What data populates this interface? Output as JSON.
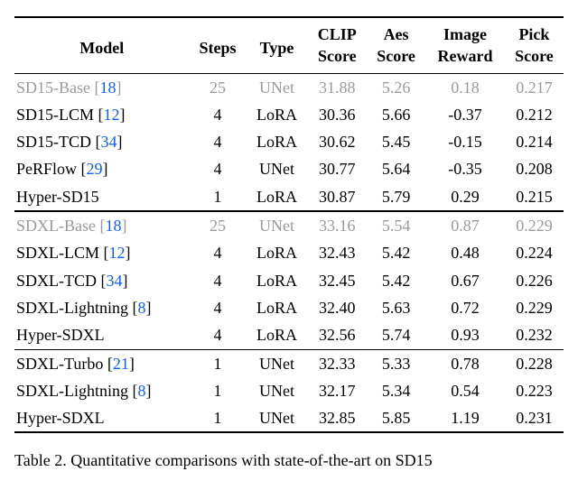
{
  "chart_data": {
    "type": "table",
    "title": "Table 2",
    "columns": [
      "Model",
      "Steps",
      "Type",
      "CLIP Score",
      "Aes Score",
      "Image Reward",
      "Pick Score"
    ],
    "groups": [
      {
        "rows": [
          {
            "model": "SD15-Base",
            "cite": "18",
            "steps": 25,
            "type": "UNet",
            "clip": 31.88,
            "aes": 5.26,
            "ir": 0.18,
            "pick": 0.217,
            "muted": true
          },
          {
            "model": "SD15-LCM",
            "cite": "12",
            "steps": 4,
            "type": "LoRA",
            "clip": 30.36,
            "aes": 5.66,
            "ir": -0.37,
            "pick": 0.212
          },
          {
            "model": "SD15-TCD",
            "cite": "34",
            "steps": 4,
            "type": "LoRA",
            "clip": 30.62,
            "aes": 5.45,
            "ir": -0.15,
            "pick": 0.214
          },
          {
            "model": "PeRFlow",
            "cite": "29",
            "steps": 4,
            "type": "UNet",
            "clip": 30.77,
            "aes": 5.64,
            "ir": -0.35,
            "pick": 0.208
          },
          {
            "model": "Hyper-SD15",
            "steps": 1,
            "type": "LoRA",
            "clip": 30.87,
            "aes": 5.79,
            "ir": 0.29,
            "pick": 0.215,
            "bold": true
          }
        ]
      },
      {
        "rows": [
          {
            "model": "SDXL-Base",
            "cite": "18",
            "steps": 25,
            "type": "UNet",
            "clip": 33.16,
            "aes": 5.54,
            "ir": 0.87,
            "pick": 0.229,
            "muted": true
          },
          {
            "model": "SDXL-LCM",
            "cite": "12",
            "steps": 4,
            "type": "LoRA",
            "clip": 32.43,
            "aes": 5.42,
            "ir": 0.48,
            "pick": 0.224
          },
          {
            "model": "SDXL-TCD",
            "cite": "34",
            "steps": 4,
            "type": "LoRA",
            "clip": 32.45,
            "aes": 5.42,
            "ir": 0.67,
            "pick": 0.226
          },
          {
            "model": "SDXL-Lightning",
            "cite": "8",
            "steps": 4,
            "type": "LoRA",
            "clip": 32.4,
            "aes": 5.63,
            "ir": 0.72,
            "pick": 0.229
          },
          {
            "model": "Hyper-SDXL",
            "steps": 4,
            "type": "LoRA",
            "clip": 32.56,
            "aes": 5.74,
            "ir": 0.93,
            "pick": 0.232,
            "bold": true
          }
        ]
      },
      {
        "rows": [
          {
            "model": "SDXL-Turbo",
            "cite": "21",
            "steps": 1,
            "type": "UNet",
            "clip": 32.33,
            "aes": 5.33,
            "ir": 0.78,
            "pick": 0.228
          },
          {
            "model": "SDXL-Lightning",
            "cite": "8",
            "steps": 1,
            "type": "UNet",
            "clip": 32.17,
            "aes": 5.34,
            "ir": 0.54,
            "pick": 0.223
          },
          {
            "model": "Hyper-SDXL",
            "steps": 1,
            "type": "UNet",
            "clip": 32.85,
            "aes": 5.85,
            "ir": 1.19,
            "pick": 0.231,
            "bold": true
          }
        ]
      }
    ]
  },
  "header": {
    "model": "Model",
    "steps": "Steps",
    "type": "Type",
    "clip_top": "CLIP",
    "clip_bot": "Score",
    "aes_top": "Aes",
    "aes_bot": "Score",
    "ir_top": "Image",
    "ir_bot": "Reward",
    "pick_top": "Pick",
    "pick_bot": "Score"
  },
  "rows": {
    "g0r0": {
      "model": "SD15-Base",
      "cite": "18",
      "steps": "25",
      "type": "UNet",
      "clip": "31.88",
      "aes": "5.26",
      "ir": "0.18",
      "pick": "0.217"
    },
    "g0r1": {
      "model": "SD15-LCM",
      "cite": "12",
      "steps": "4",
      "type": "LoRA",
      "clip": "30.36",
      "aes": "5.66",
      "ir": "-0.37",
      "pick": "0.212"
    },
    "g0r2": {
      "model": "SD15-TCD",
      "cite": "34",
      "steps": "4",
      "type": "LoRA",
      "clip": "30.62",
      "aes": "5.45",
      "ir": "-0.15",
      "pick": "0.214"
    },
    "g0r3": {
      "model": "PeRFlow",
      "cite": "29",
      "steps": "4",
      "type": "UNet",
      "clip": "30.77",
      "aes": "5.64",
      "ir": "-0.35",
      "pick": "0.208"
    },
    "g0r4": {
      "model": "Hyper-SD15",
      "steps": "1",
      "type": "LoRA",
      "clip": "30.87",
      "aes": "5.79",
      "ir": "0.29",
      "pick": "0.215"
    },
    "g1r0": {
      "model": "SDXL-Base",
      "cite": "18",
      "steps": "25",
      "type": "UNet",
      "clip": "33.16",
      "aes": "5.54",
      "ir": "0.87",
      "pick": "0.229"
    },
    "g1r1": {
      "model": "SDXL-LCM",
      "cite": "12",
      "steps": "4",
      "type": "LoRA",
      "clip": "32.43",
      "aes": "5.42",
      "ir": "0.48",
      "pick": "0.224"
    },
    "g1r2": {
      "model": "SDXL-TCD",
      "cite": "34",
      "steps": "4",
      "type": "LoRA",
      "clip": "32.45",
      "aes": "5.42",
      "ir": "0.67",
      "pick": "0.226"
    },
    "g1r3": {
      "model": "SDXL-Lightning",
      "cite": "8",
      "steps": "4",
      "type": "LoRA",
      "clip": "32.40",
      "aes": "5.63",
      "ir": "0.72",
      "pick": "0.229"
    },
    "g1r4": {
      "model": "Hyper-SDXL",
      "steps": "4",
      "type": "LoRA",
      "clip": "32.56",
      "aes": "5.74",
      "ir": "0.93",
      "pick": "0.232"
    },
    "g2r0": {
      "model": "SDXL-Turbo",
      "cite": "21",
      "steps": "1",
      "type": "UNet",
      "clip": "32.33",
      "aes": "5.33",
      "ir": "0.78",
      "pick": "0.228"
    },
    "g2r1": {
      "model": "SDXL-Lightning",
      "cite": "8",
      "steps": "1",
      "type": "UNet",
      "clip": "32.17",
      "aes": "5.34",
      "ir": "0.54",
      "pick": "0.223"
    },
    "g2r2": {
      "model": "Hyper-SDXL",
      "steps": "1",
      "type": "UNet",
      "clip": "32.85",
      "aes": "5.85",
      "ir": "1.19",
      "pick": "0.231"
    }
  },
  "caption": {
    "lead": "Table 2. ",
    "text_partial": "Quantitative comparisons with state-of-the-art on SD15"
  }
}
